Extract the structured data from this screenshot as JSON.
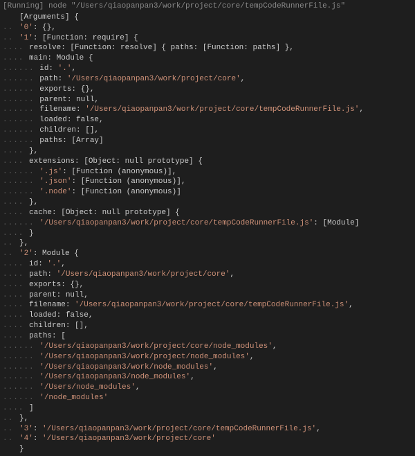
{
  "header": "[Running] node \"/Users/qiaopanpan3/work/project/core/tempCodeRunnerFile.js\"",
  "lines": [
    {
      "indent": 0,
      "gutter": "",
      "text": "[Arguments] {"
    },
    {
      "indent": 1,
      "gutter": "..",
      "text": "'0': {},"
    },
    {
      "indent": 1,
      "gutter": "..",
      "text": "'1': [Function: require] {"
    },
    {
      "indent": 2,
      "gutter": "....",
      "text": "resolve: [Function: resolve] { paths: [Function: paths] },"
    },
    {
      "indent": 2,
      "gutter": "....",
      "text": "main: Module {"
    },
    {
      "indent": 3,
      "gutter": "......",
      "text": "id: '.',"
    },
    {
      "indent": 3,
      "gutter": "......",
      "text": "path: '/Users/qiaopanpan3/work/project/core',"
    },
    {
      "indent": 3,
      "gutter": "......",
      "text": "exports: {},"
    },
    {
      "indent": 3,
      "gutter": "......",
      "text": "parent: null,"
    },
    {
      "indent": 3,
      "gutter": "......",
      "text": "filename: '/Users/qiaopanpan3/work/project/core/tempCodeRunnerFile.js',"
    },
    {
      "indent": 3,
      "gutter": "......",
      "text": "loaded: false,"
    },
    {
      "indent": 3,
      "gutter": "......",
      "text": "children: [],"
    },
    {
      "indent": 3,
      "gutter": "......",
      "text": "paths: [Array]"
    },
    {
      "indent": 2,
      "gutter": "....",
      "text": "},"
    },
    {
      "indent": 2,
      "gutter": "....",
      "text": "extensions: [Object: null prototype] {"
    },
    {
      "indent": 3,
      "gutter": "......",
      "text": "'.js': [Function (anonymous)],"
    },
    {
      "indent": 3,
      "gutter": "......",
      "text": "'.json': [Function (anonymous)],"
    },
    {
      "indent": 3,
      "gutter": "......",
      "text": "'.node': [Function (anonymous)]"
    },
    {
      "indent": 2,
      "gutter": "....",
      "text": "},"
    },
    {
      "indent": 2,
      "gutter": "....",
      "text": "cache: [Object: null prototype] {"
    },
    {
      "indent": 3,
      "gutter": "......",
      "text": "'/Users/qiaopanpan3/work/project/core/tempCodeRunnerFile.js': [Module]"
    },
    {
      "indent": 2,
      "gutter": "....",
      "text": "}"
    },
    {
      "indent": 1,
      "gutter": "..",
      "text": "},"
    },
    {
      "indent": 1,
      "gutter": "..",
      "text": "'2': Module {"
    },
    {
      "indent": 2,
      "gutter": "....",
      "text": "id: '.',"
    },
    {
      "indent": 2,
      "gutter": "....",
      "text": "path: '/Users/qiaopanpan3/work/project/core',"
    },
    {
      "indent": 2,
      "gutter": "....",
      "text": "exports: {},"
    },
    {
      "indent": 2,
      "gutter": "....",
      "text": "parent: null,"
    },
    {
      "indent": 2,
      "gutter": "....",
      "text": "filename: '/Users/qiaopanpan3/work/project/core/tempCodeRunnerFile.js',"
    },
    {
      "indent": 2,
      "gutter": "....",
      "text": "loaded: false,"
    },
    {
      "indent": 2,
      "gutter": "....",
      "text": "children: [],"
    },
    {
      "indent": 2,
      "gutter": "....",
      "text": "paths: ["
    },
    {
      "indent": 3,
      "gutter": "......",
      "text": "'/Users/qiaopanpan3/work/project/core/node_modules',"
    },
    {
      "indent": 3,
      "gutter": "......",
      "text": "'/Users/qiaopanpan3/work/project/node_modules',"
    },
    {
      "indent": 3,
      "gutter": "......",
      "text": "'/Users/qiaopanpan3/work/node_modules',"
    },
    {
      "indent": 3,
      "gutter": "......",
      "text": "'/Users/qiaopanpan3/node_modules',"
    },
    {
      "indent": 3,
      "gutter": "......",
      "text": "'/Users/node_modules',"
    },
    {
      "indent": 3,
      "gutter": "......",
      "text": "'/node_modules'"
    },
    {
      "indent": 2,
      "gutter": "....",
      "text": "]"
    },
    {
      "indent": 1,
      "gutter": "..",
      "text": "},"
    },
    {
      "indent": 1,
      "gutter": "..",
      "text": "'3': '/Users/qiaopanpan3/work/project/core/tempCodeRunnerFile.js',"
    },
    {
      "indent": 1,
      "gutter": "..",
      "text": "'4': '/Users/qiaopanpan3/work/project/core'"
    },
    {
      "indent": 0,
      "gutter": "",
      "text": "}"
    }
  ]
}
